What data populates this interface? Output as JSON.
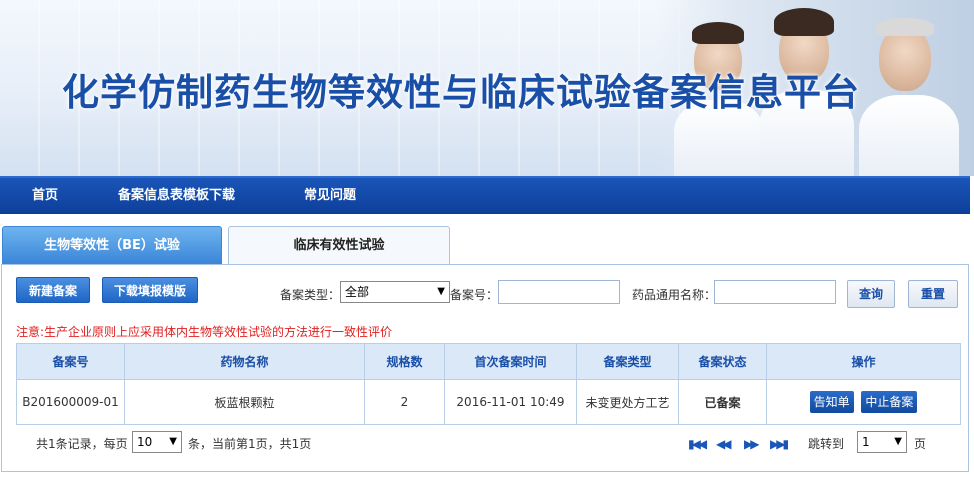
{
  "banner": {
    "title": "化学仿制药生物等效性与临床试验备案信息平台"
  },
  "nav": {
    "items": [
      "首页",
      "备案信息表模板下载",
      "常见问题"
    ]
  },
  "tabs": {
    "be": "生物等效性（BE）试验",
    "clinical": "临床有效性试验"
  },
  "toolbar": {
    "new_button": "新建备案",
    "download_button": "下载填报模版",
    "type_label": "备案类型：",
    "type_value": "全部",
    "record_no_label": "备案号：",
    "drug_name_label": "药品通用名称：",
    "query_button": "查询",
    "reset_button": "重置"
  },
  "notice": "注意:生产企业原则上应采用体内生物等效性试验的方法进行一致性评价",
  "table": {
    "headers": [
      "备案号",
      "药物名称",
      "规格数",
      "首次备案时间",
      "备案类型",
      "备案状态",
      "操作"
    ],
    "rows": [
      {
        "no": "B201600009-01",
        "name": "板蓝根颗粒",
        "specs": "2",
        "time": "2016-11-01 10:49",
        "type": "未变更处方工艺",
        "status": "已备案",
        "actions": [
          "告知单",
          "中止备案"
        ]
      }
    ]
  },
  "pager": {
    "summary_prefix": "共1条记录，每页",
    "page_size": "10",
    "summary_suffix": "条，当前第1页，共1页",
    "jump_label": "跳转到",
    "jump_value": "1",
    "page_unit": "页"
  },
  "colors": {
    "brand": "#1a4fa8",
    "nav": "#0d3f9a",
    "notice": "#e02020",
    "ok": "#18a018"
  }
}
